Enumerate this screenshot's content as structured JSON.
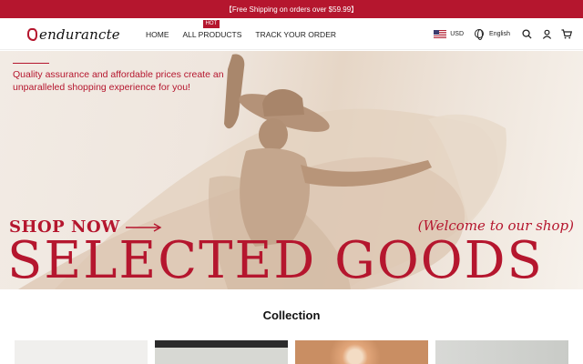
{
  "announcement": "【Free Shipping on orders over $59.99】",
  "brand": {
    "name": "endurancte",
    "accent": "#b5162e"
  },
  "nav": {
    "items": [
      "HOME",
      "ALL PRODUCTS",
      "TRACK YOUR ORDER"
    ],
    "hot_badge": "HOT"
  },
  "utilities": {
    "currency": "USD",
    "language": "English",
    "icons": [
      "us-flag-icon",
      "globe-icon",
      "search-icon",
      "user-icon",
      "cart-icon"
    ]
  },
  "hero": {
    "tagline": "Quality assurance and affordable prices create an unparalleled shopping experience for you!",
    "cta": "SHOP NOW",
    "welcome": "(Welcome to our shop)",
    "headline": "SELECTED GOODS"
  },
  "collection": {
    "title": "Collection",
    "tiles": [
      {
        "tone": "#f0efed"
      },
      {
        "tone": "#cfd1cc"
      },
      {
        "tone": "#e2b48c"
      },
      {
        "tone": "#d8d9d6"
      }
    ]
  }
}
